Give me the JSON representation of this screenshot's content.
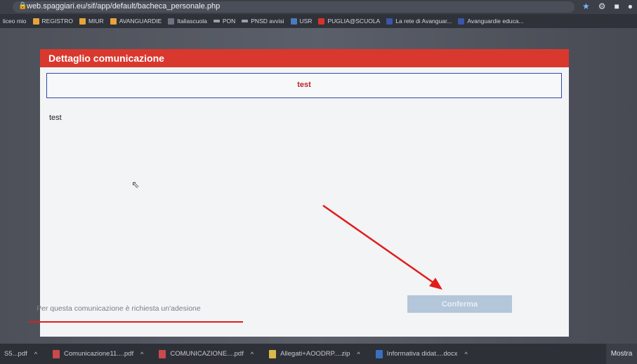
{
  "browser": {
    "url": "web.spaggiari.eu/sif/app/default/bacheca_personale.php",
    "bookmarks": [
      {
        "label": "liceo mio",
        "color": ""
      },
      {
        "label": "REGISTRO",
        "color": "#e8a33a"
      },
      {
        "label": "MIUR",
        "color": "#e8a33a"
      },
      {
        "label": "AVANGUARDIE",
        "color": "#e8a33a"
      },
      {
        "label": "Italiascuola",
        "color": "#6f7380"
      },
      {
        "label": "PON",
        "color": "#9aa0ad"
      },
      {
        "label": "PNSD avvisi",
        "color": "#9aa0ad"
      },
      {
        "label": "USR",
        "color": "#4a7ac0"
      },
      {
        "label": "PUGLIA@SCUOLA",
        "color": "#d9322b"
      },
      {
        "label": "La rete di Avanguar...",
        "color": "#3a56a8"
      },
      {
        "label": "Avanguardie educa...",
        "color": "#3a56a8"
      }
    ]
  },
  "modal": {
    "title": "Dettaglio comunicazione",
    "subject": "test",
    "body": "test",
    "notice": "Per questa comunicazione è richiesta un'adesione",
    "confirm_label": "Conferma"
  },
  "downloads": {
    "items": [
      {
        "name": "S5...pdf",
        "color": "#c94a4a"
      },
      {
        "name": "Comunicazione11....pdf",
        "color": "#c94a4a"
      },
      {
        "name": "COMUNICAZIONE....pdf",
        "color": "#c94a4a"
      },
      {
        "name": "Allegati+AOODRP....zip",
        "color": "#d9b84a"
      },
      {
        "name": "Informativa didat....docx",
        "color": "#3a6fc0"
      }
    ],
    "show_all": "Mostra"
  },
  "colors": {
    "header_red": "#d9382f",
    "subject_text": "#b7262c",
    "annotation_red": "#e21b1b",
    "button_disabled": "#b3c6da"
  }
}
